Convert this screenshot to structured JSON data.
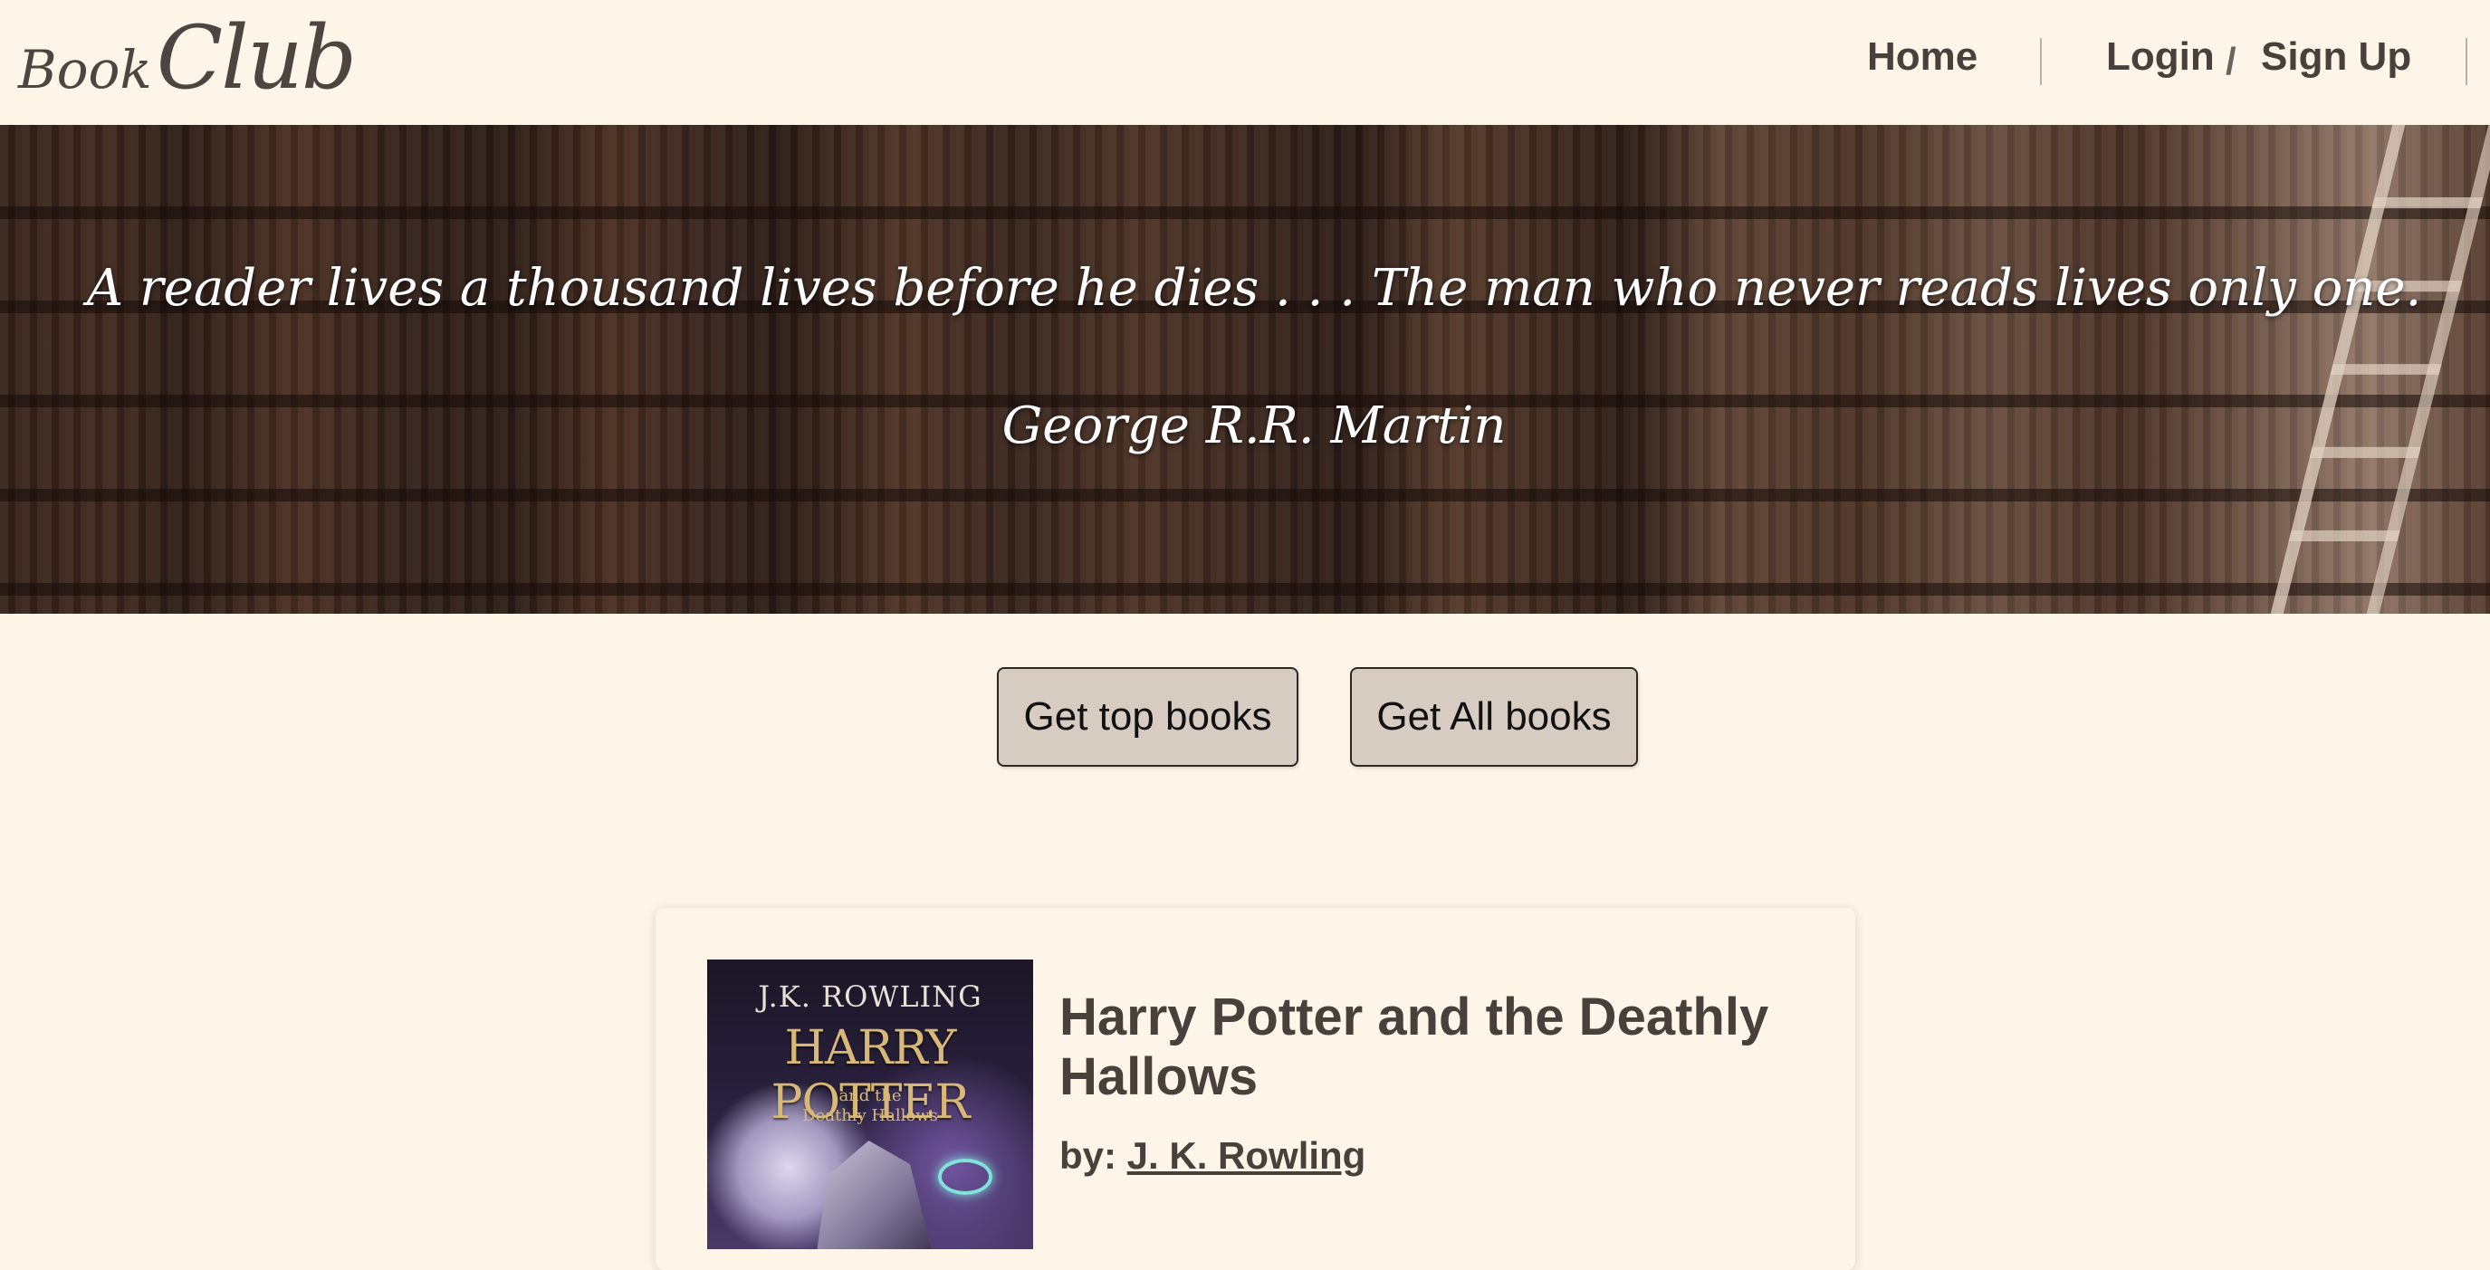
{
  "header": {
    "logo_small": "Book",
    "logo_big": "Club",
    "nav": {
      "home": "Home",
      "login": "Login",
      "slash": "/",
      "signup": "Sign Up"
    }
  },
  "hero": {
    "quote": "A reader lives a thousand lives before he dies . . . The man who never reads lives only one.",
    "author": "George R.R. Martin"
  },
  "actions": {
    "top_books": "Get top books",
    "all_books": "Get All books"
  },
  "book": {
    "cover_author": "J.K. ROWLING",
    "cover_title": "HARRY POTTER",
    "cover_subtitle_line1": "and the",
    "cover_subtitle_line2": "Deathly Hallows",
    "title": "Harry Potter and the Deathly Hallows",
    "by_label": "by:",
    "author": "J. K. Rowling"
  }
}
